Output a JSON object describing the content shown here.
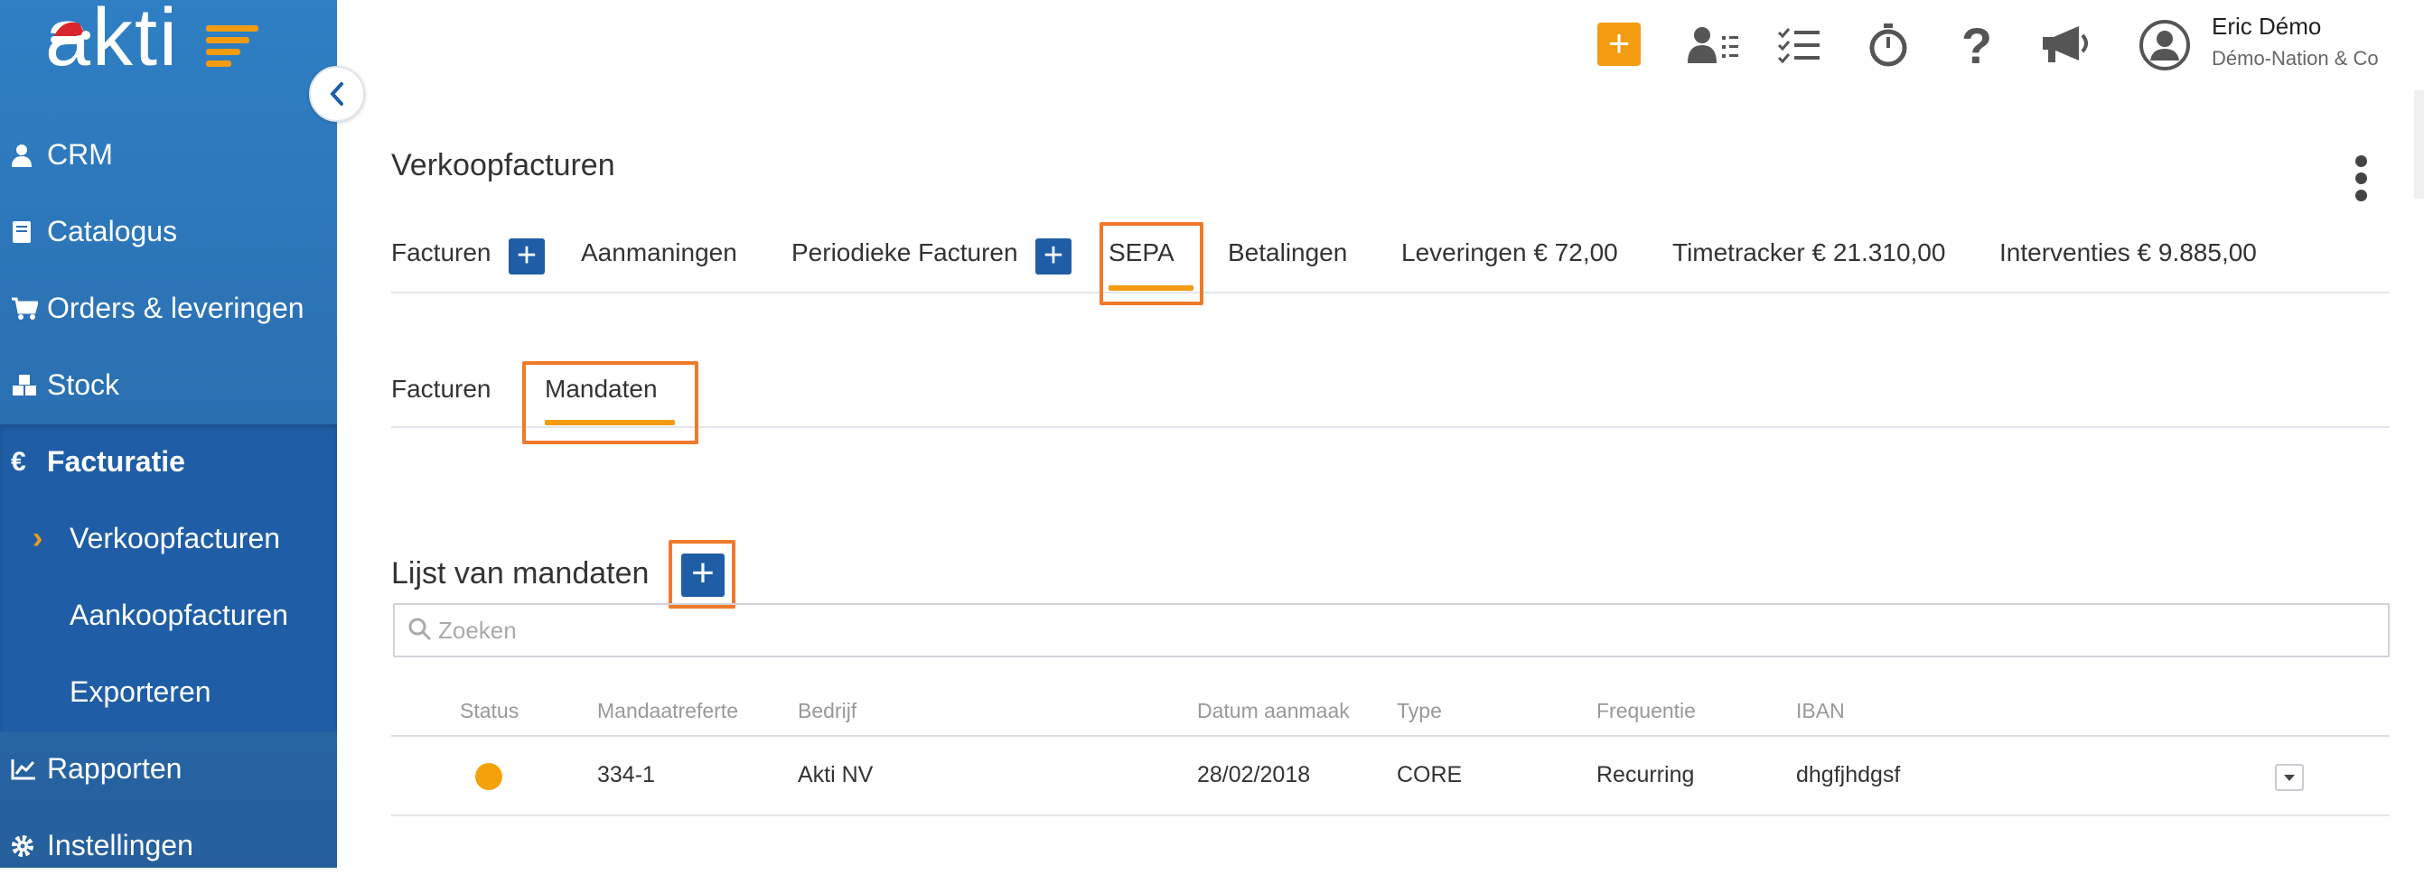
{
  "app": {
    "logo_text": "akti"
  },
  "sidebar": {
    "items": [
      {
        "label": "CRM",
        "icon": "user-icon"
      },
      {
        "label": "Catalogus",
        "icon": "book-icon"
      },
      {
        "label": "Orders & leveringen",
        "icon": "cart-icon"
      },
      {
        "label": "Stock",
        "icon": "cubes-icon"
      },
      {
        "label": "Facturatie",
        "icon": "euro-icon"
      },
      {
        "label": "Rapporten",
        "icon": "chart-icon"
      },
      {
        "label": "Instellingen",
        "icon": "gear-icon"
      }
    ],
    "sub_items": [
      {
        "label": "Verkoopfacturen",
        "active": true
      },
      {
        "label": "Aankoopfacturen"
      },
      {
        "label": "Exporteren"
      }
    ]
  },
  "topbar": {
    "icons": [
      "add-icon",
      "contacts-icon",
      "tasks-icon",
      "stopwatch-icon",
      "help-icon",
      "megaphone-icon",
      "user-circle-icon"
    ],
    "user": {
      "name": "Eric Démo",
      "company": "Démo-Nation & Co"
    }
  },
  "page": {
    "title": "Verkoopfacturen",
    "tabs": [
      {
        "label": "Facturen",
        "has_add": true
      },
      {
        "label": "Aanmaningen"
      },
      {
        "label": "Periodieke Facturen",
        "has_add": true
      },
      {
        "label": "SEPA",
        "active": true
      },
      {
        "label": "Betalingen"
      },
      {
        "label": "Leveringen € 72,00"
      },
      {
        "label": "Timetracker € 21.310,00"
      },
      {
        "label": "Interventies € 9.885,00"
      }
    ],
    "subtabs": [
      {
        "label": "Facturen"
      },
      {
        "label": "Mandaten",
        "active": true
      }
    ]
  },
  "mandates": {
    "title": "Lijst van mandaten",
    "search_placeholder": "Zoeken",
    "columns": [
      "Status",
      "Mandaatreferte",
      "Bedrijf",
      "Datum aanmaak",
      "Type",
      "Frequentie",
      "IBAN"
    ],
    "rows": [
      {
        "status_color": "#f5a20a",
        "reference": "334-1",
        "company": "Akti NV",
        "date": "28/02/2018",
        "type": "CORE",
        "frequency": "Recurring",
        "iban": "dhgfjhdgsf"
      }
    ]
  },
  "colors": {
    "sidebar": "#2a6fb0",
    "accent": "#f39c12",
    "primary_button": "#1f5ea6",
    "highlight_box": "#f07a2a"
  }
}
